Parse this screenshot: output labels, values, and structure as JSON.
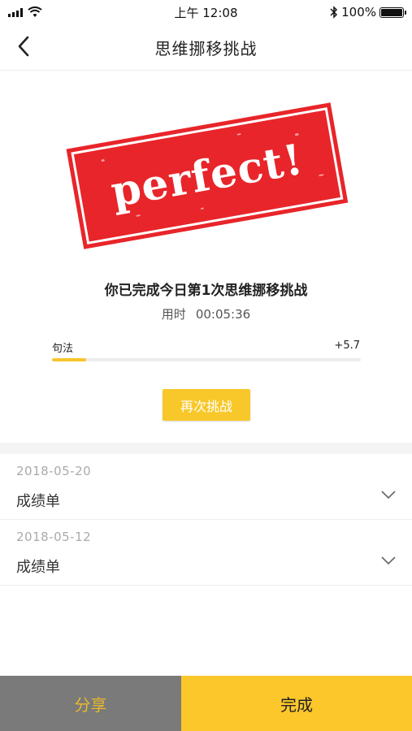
{
  "status_bar": {
    "time": "上午 12:08",
    "battery": "100%"
  },
  "nav": {
    "title": "思维挪移挑战",
    "back_icon": "chevron-left-icon"
  },
  "stamp": {
    "text": "perfect!",
    "color": "#e8252a"
  },
  "result": {
    "title": "你已完成今日第1次思维挪移挑战",
    "time_label": "用时",
    "time_value": "00:05:36"
  },
  "progress": {
    "label": "句法",
    "value": "+5.7",
    "fill_percent": 11,
    "accent": "#f7c52d"
  },
  "retry_button": "再次挑战",
  "records": [
    {
      "date": "2018-05-20",
      "label": "成绩单"
    },
    {
      "date": "2018-05-12",
      "label": "成绩单"
    }
  ],
  "bottom_bar": {
    "share_label": "分享",
    "done_label": "完成"
  }
}
